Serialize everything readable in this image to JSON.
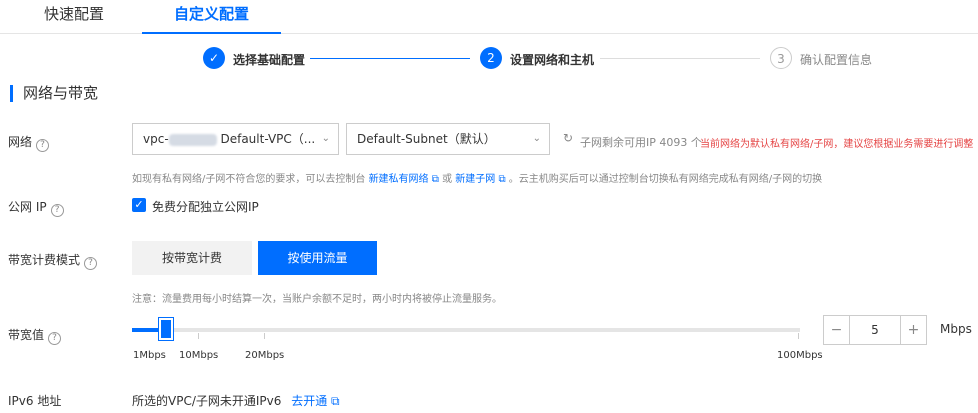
{
  "tabs": {
    "quick": "快速配置",
    "custom": "自定义配置"
  },
  "steps": [
    {
      "index": "✓",
      "label": "选择基础配置",
      "state": "done"
    },
    {
      "index": "2",
      "label": "设置网络和主机",
      "state": "current"
    },
    {
      "index": "3",
      "label": "确认配置信息",
      "state": "pending"
    }
  ],
  "section_title": "网络与带宽",
  "network": {
    "label": "网络",
    "vpc_prefix": "vpc-",
    "vpc_name": "Default-VPC（...",
    "subnet": "Default-Subnet（默认）",
    "ip_remaining": "子网剩余可用IP 4093 个",
    "warning": "当前网络为默认私有网络/子网，建议您根据业务需要进行调整",
    "note_prefix": "如现有私有网络/子网不符合您的要求，可以去控制台",
    "link_new_vpc": "新建私有网络",
    "note_or": "或",
    "link_new_subnet": "新建子网",
    "note_suffix": "。云主机购买后可以通过控制台切换私有网络完成私有网络/子网的切换"
  },
  "public_ip": {
    "label": "公网 IP",
    "checkbox_label": "免费分配独立公网IP",
    "checked": true
  },
  "billing": {
    "label": "带宽计费模式",
    "option_bandwidth": "按带宽计费",
    "option_traffic": "按使用流量",
    "selected": "按使用流量",
    "note": "注意：流量费用每小时结算一次，当账户余额不足时，两小时内将被停止流量服务。"
  },
  "bandwidth": {
    "label": "带宽值",
    "value": "5",
    "unit": "Mbps",
    "minus": "−",
    "plus": "+",
    "ticks": [
      "1Mbps",
      "10Mbps",
      "20Mbps",
      "100Mbps"
    ],
    "level_fraction": 0.05
  },
  "ipv6": {
    "label": "IPv6 地址",
    "text": "所选的VPC/子网未开通IPv6",
    "link": "去开通"
  }
}
